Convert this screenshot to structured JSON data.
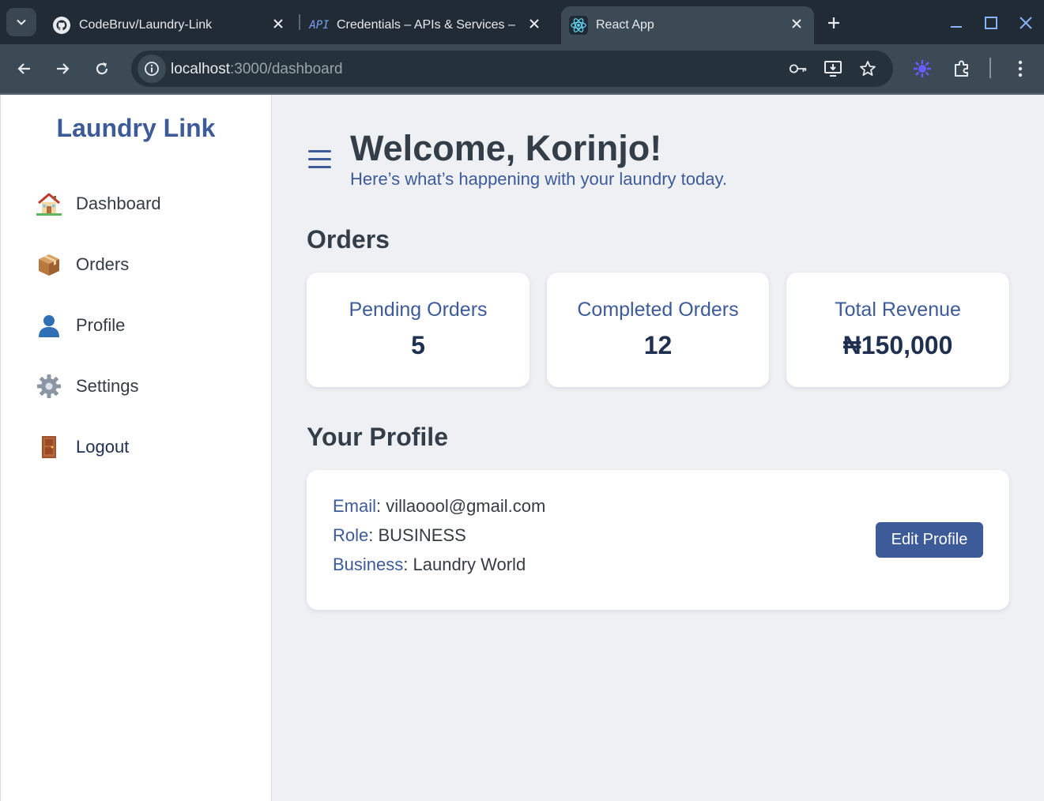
{
  "browser": {
    "tabs": [
      {
        "title": "CodeBruv/Laundry-Link",
        "icon": "github-icon"
      },
      {
        "title": "Credentials – APIs & Services –",
        "icon": "api-icon",
        "icon_text": "API"
      },
      {
        "title": "React App",
        "icon": "react-icon"
      }
    ],
    "url": {
      "host": "localhost",
      "path": ":3000/dashboard"
    },
    "colors": {
      "tabbar": "#202b35",
      "toolbar": "#3b4a55",
      "omnibox": "#26323b"
    }
  },
  "sidebar": {
    "brand": "Laundry Link",
    "items": [
      {
        "label": "Dashboard",
        "icon": "house-icon"
      },
      {
        "label": "Orders",
        "icon": "package-icon"
      },
      {
        "label": "Profile",
        "icon": "user-icon"
      },
      {
        "label": "Settings",
        "icon": "gear-icon"
      },
      {
        "label": "Logout",
        "icon": "door-icon"
      }
    ]
  },
  "header": {
    "welcome": "Welcome, Korinjo!",
    "subtitle": "Here’s what’s happening with your laundry today."
  },
  "orders": {
    "title": "Orders",
    "cards": [
      {
        "label": "Pending Orders",
        "value": "5"
      },
      {
        "label": "Completed Orders",
        "value": "12"
      },
      {
        "label": "Total Revenue",
        "value": "₦150,000"
      }
    ]
  },
  "profile": {
    "title": "Your Profile",
    "rows": [
      {
        "key": "Email",
        "value": "villaoool@gmail.com"
      },
      {
        "key": "Role",
        "value": "BUSINESS"
      },
      {
        "key": "Business",
        "value": "Laundry World"
      }
    ],
    "edit_label": "Edit Profile"
  },
  "colors": {
    "accent": "#3d5a99",
    "background": "#eef0f4",
    "text_dark": "#343e48"
  }
}
